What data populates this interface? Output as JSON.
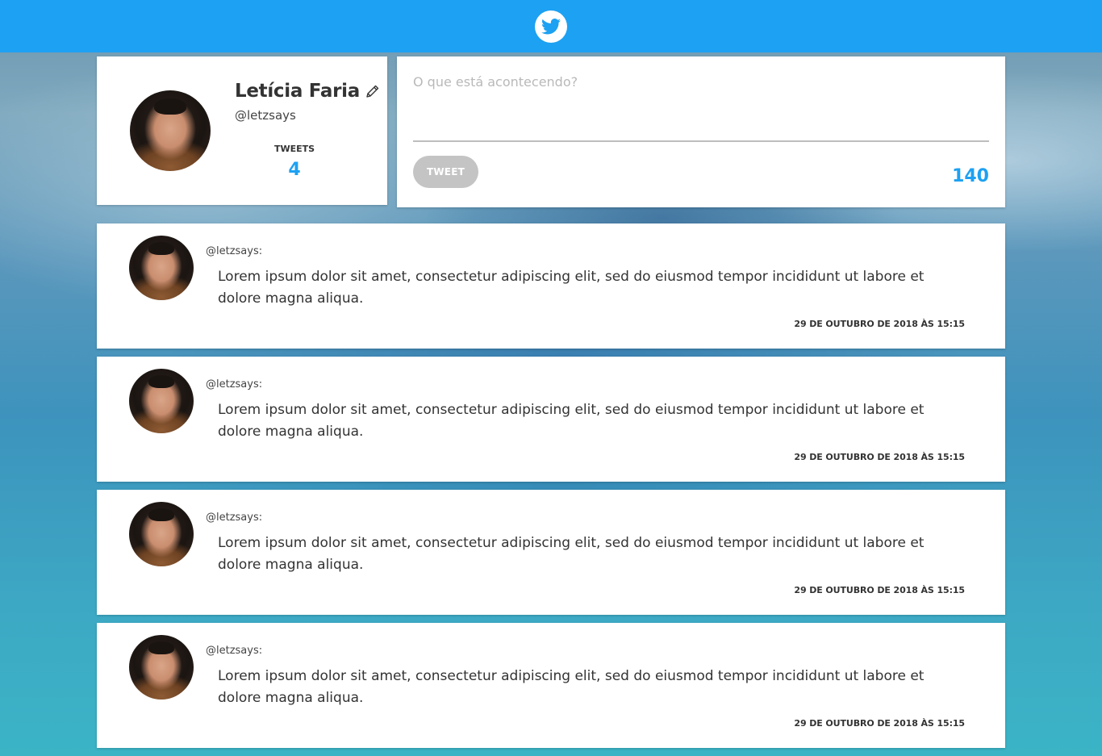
{
  "header": {
    "logo_icon": "twitter-bird-icon",
    "brand_color": "#1da1f2"
  },
  "profile": {
    "name": "Letícia Faria",
    "handle": "@letzsays",
    "tweets_label": "TWEETS",
    "tweets_count": "4",
    "edit_icon": "pencil-icon"
  },
  "compose": {
    "placeholder": "O que está acontecendo?",
    "value": "",
    "button_label": "TWEET",
    "remaining_chars": "140"
  },
  "tweets": [
    {
      "user": "@letzsays:",
      "text": "Lorem ipsum dolor sit amet, consectetur adipiscing elit, sed do eiusmod tempor incididunt ut labore et dolore magna aliqua.",
      "date": "29 DE OUTUBRO DE 2018 ÀS 15:15"
    },
    {
      "user": "@letzsays:",
      "text": "Lorem ipsum dolor sit amet, consectetur adipiscing elit, sed do eiusmod tempor incididunt ut labore et dolore magna aliqua.",
      "date": "29 DE OUTUBRO DE 2018 ÀS 15:15"
    },
    {
      "user": "@letzsays:",
      "text": "Lorem ipsum dolor sit amet, consectetur adipiscing elit, sed do eiusmod tempor incididunt ut labore et dolore magna aliqua.",
      "date": "29 DE OUTUBRO DE 2018 ÀS 15:15"
    },
    {
      "user": "@letzsays:",
      "text": "Lorem ipsum dolor sit amet, consectetur adipiscing elit, sed do eiusmod tempor incididunt ut labore et dolore magna aliqua.",
      "date": "29 DE OUTUBRO DE 2018 ÀS 15:15"
    }
  ]
}
